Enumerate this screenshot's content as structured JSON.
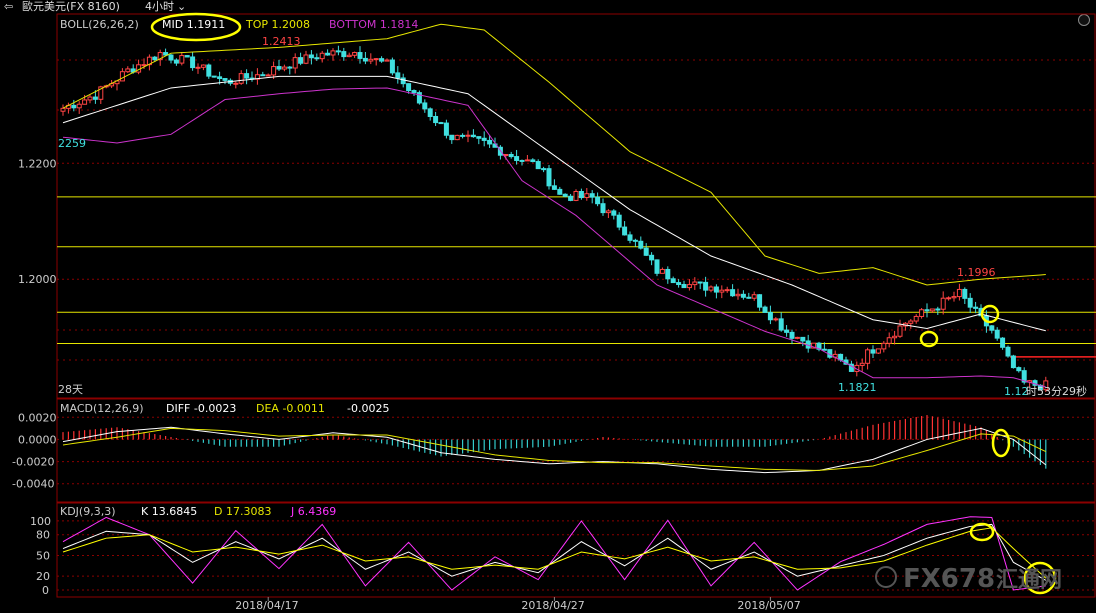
{
  "window": {
    "title": "歐元美元(FX 8160)",
    "period": "4小时"
  },
  "colors": {
    "up": "#ff4444",
    "down": "#40e0e0",
    "mid": "#ffffff",
    "top": "#e6e600",
    "bottom": "#cc33cc",
    "dead": "#ffff00",
    "grid": "#8b0000",
    "macd_pos": "#ff3333",
    "macd_neg": "#33cccc",
    "k": "#ffffff",
    "d": "#ffff00",
    "j": "#ff33ff"
  },
  "boll": {
    "label": "BOLL(26,26,2)",
    "mid_text": "MID 1.1911",
    "top_text": "TOP 1.2008",
    "bottom_text": "BOTTOM 1.1814"
  },
  "macd": {
    "label": "MACD(12,26,9)",
    "diff_text": "DIFF -0.0023",
    "dea_text": "DEA -0.0011",
    "value_text": "-0.0025"
  },
  "kdj": {
    "label": "KDJ(9,3,3)",
    "k_text": "K 13.6845",
    "d_text": "D 17.3083",
    "j_text": "J 6.4369"
  },
  "annotations": {
    "high_label": "1.2413",
    "left_label": "2259",
    "right_high_label": "1.1996",
    "low_label": "1.1821",
    "days_label": "28天",
    "last_label": "1.12",
    "countdown_label": "时53分29秒",
    "watermark": "FX678",
    "watermark_suffix": "汇通网"
  },
  "chart_data": {
    "type": "candlestick",
    "instrument": "歐元美元(FX 8160)",
    "interval": "4小时",
    "x_ticks": [
      {
        "index": 38,
        "label": "2018/04/17"
      },
      {
        "index": 91,
        "label": "2018/04/27"
      },
      {
        "index": 131,
        "label": "2018/05/07"
      }
    ],
    "price_ticks": [
      {
        "value": 1.22,
        "label": "1.2200"
      },
      {
        "value": 1.2,
        "label": "1.2000"
      }
    ],
    "macd_ticks": [
      {
        "value": 0.002,
        "label": "0.0020"
      },
      {
        "value": 0.0,
        "label": "0.0000"
      },
      {
        "value": -0.002,
        "label": "-0.0020"
      },
      {
        "value": -0.004,
        "label": "-0.0040"
      }
    ],
    "kdj_ticks": [
      {
        "value": 100,
        "label": "100"
      },
      {
        "value": 80,
        "label": "80"
      },
      {
        "value": 50,
        "label": "50"
      },
      {
        "value": 20,
        "label": "20"
      },
      {
        "value": 0,
        "label": "0"
      }
    ],
    "horizontal_levels": [
      1.2142,
      1.2056,
      1.1943,
      1.1889
    ],
    "current_price": 1.1866,
    "close_anchors": [
      [
        0,
        1.2295
      ],
      [
        6,
        1.2318
      ],
      [
        12,
        1.236
      ],
      [
        18,
        1.239
      ],
      [
        24,
        1.2372
      ],
      [
        30,
        1.234
      ],
      [
        36,
        1.2352
      ],
      [
        42,
        1.2372
      ],
      [
        48,
        1.2388
      ],
      [
        54,
        1.2392
      ],
      [
        60,
        1.237
      ],
      [
        66,
        1.2305
      ],
      [
        72,
        1.2245
      ],
      [
        78,
        1.2235
      ],
      [
        84,
        1.221
      ],
      [
        88,
        1.2195
      ],
      [
        92,
        1.2145
      ],
      [
        98,
        1.214
      ],
      [
        104,
        1.2085
      ],
      [
        110,
        1.2015
      ],
      [
        116,
        1.199
      ],
      [
        122,
        1.1985
      ],
      [
        128,
        1.1968
      ],
      [
        134,
        1.191
      ],
      [
        140,
        1.188
      ],
      [
        146,
        1.1845
      ],
      [
        150,
        1.188
      ],
      [
        156,
        1.1925
      ],
      [
        162,
        1.1955
      ],
      [
        166,
        1.1975
      ],
      [
        170,
        1.193
      ],
      [
        172,
        1.1912
      ],
      [
        175,
        1.186
      ],
      [
        178,
        1.182
      ],
      [
        182,
        1.1816
      ]
    ],
    "mid_anchors": [
      [
        0,
        1.227
      ],
      [
        20,
        1.233
      ],
      [
        40,
        1.235
      ],
      [
        60,
        1.235
      ],
      [
        75,
        1.232
      ],
      [
        90,
        1.222
      ],
      [
        105,
        1.212
      ],
      [
        120,
        1.204
      ],
      [
        135,
        1.199
      ],
      [
        150,
        1.193
      ],
      [
        160,
        1.1915
      ],
      [
        170,
        1.194
      ],
      [
        182,
        1.1911
      ]
    ],
    "top_anchors": [
      [
        0,
        1.2295
      ],
      [
        20,
        1.239
      ],
      [
        40,
        1.24
      ],
      [
        60,
        1.2415
      ],
      [
        70,
        1.244
      ],
      [
        78,
        1.243
      ],
      [
        90,
        1.234
      ],
      [
        105,
        1.222
      ],
      [
        120,
        1.215
      ],
      [
        130,
        1.204
      ],
      [
        140,
        1.201
      ],
      [
        150,
        1.202
      ],
      [
        160,
        1.199
      ],
      [
        170,
        1.2
      ],
      [
        182,
        1.2008
      ]
    ],
    "bottom_anchors": [
      [
        0,
        1.2245
      ],
      [
        10,
        1.2235
      ],
      [
        20,
        1.225
      ],
      [
        30,
        1.231
      ],
      [
        40,
        1.232
      ],
      [
        50,
        1.2328
      ],
      [
        60,
        1.233
      ],
      [
        75,
        1.23
      ],
      [
        85,
        1.217
      ],
      [
        95,
        1.211
      ],
      [
        110,
        1.199
      ],
      [
        120,
        1.195
      ],
      [
        130,
        1.191
      ],
      [
        140,
        1.188
      ],
      [
        150,
        1.183
      ],
      [
        160,
        1.183
      ],
      [
        170,
        1.1833
      ],
      [
        176,
        1.183
      ],
      [
        182,
        1.1814
      ]
    ],
    "macd_diff_anchors": [
      [
        0,
        -0.0002
      ],
      [
        10,
        0.0007
      ],
      [
        20,
        0.0011
      ],
      [
        30,
        0.0005
      ],
      [
        40,
        0.0
      ],
      [
        50,
        0.0006
      ],
      [
        60,
        0.0002
      ],
      [
        70,
        -0.0012
      ],
      [
        80,
        -0.0018
      ],
      [
        90,
        -0.0022
      ],
      [
        100,
        -0.002
      ],
      [
        110,
        -0.0022
      ],
      [
        120,
        -0.0027
      ],
      [
        130,
        -0.003
      ],
      [
        140,
        -0.0028
      ],
      [
        150,
        -0.0018
      ],
      [
        160,
        0.0
      ],
      [
        170,
        0.001
      ],
      [
        176,
        0.0
      ],
      [
        182,
        -0.0023
      ]
    ],
    "macd_dea_anchors": [
      [
        0,
        -0.0005
      ],
      [
        10,
        0.0002
      ],
      [
        20,
        0.001
      ],
      [
        30,
        0.0008
      ],
      [
        40,
        0.0003
      ],
      [
        50,
        0.0004
      ],
      [
        60,
        0.0004
      ],
      [
        70,
        -0.0005
      ],
      [
        80,
        -0.0014
      ],
      [
        90,
        -0.0019
      ],
      [
        100,
        -0.0021
      ],
      [
        110,
        -0.0021
      ],
      [
        120,
        -0.0024
      ],
      [
        130,
        -0.0027
      ],
      [
        140,
        -0.0028
      ],
      [
        150,
        -0.0024
      ],
      [
        160,
        -0.001
      ],
      [
        170,
        0.0005
      ],
      [
        176,
        0.0003
      ],
      [
        182,
        -0.0011
      ]
    ],
    "k_anchors": [
      [
        0,
        60
      ],
      [
        8,
        85
      ],
      [
        16,
        80
      ],
      [
        24,
        40
      ],
      [
        32,
        70
      ],
      [
        40,
        45
      ],
      [
        48,
        75
      ],
      [
        56,
        30
      ],
      [
        64,
        55
      ],
      [
        72,
        20
      ],
      [
        80,
        40
      ],
      [
        88,
        25
      ],
      [
        96,
        70
      ],
      [
        104,
        35
      ],
      [
        112,
        75
      ],
      [
        120,
        30
      ],
      [
        128,
        55
      ],
      [
        136,
        20
      ],
      [
        144,
        35
      ],
      [
        152,
        50
      ],
      [
        160,
        75
      ],
      [
        168,
        92
      ],
      [
        172,
        95
      ],
      [
        176,
        40
      ],
      [
        182,
        14
      ]
    ],
    "d_anchors": [
      [
        0,
        55
      ],
      [
        8,
        75
      ],
      [
        16,
        80
      ],
      [
        24,
        55
      ],
      [
        32,
        62
      ],
      [
        40,
        52
      ],
      [
        48,
        65
      ],
      [
        56,
        42
      ],
      [
        64,
        48
      ],
      [
        72,
        30
      ],
      [
        80,
        36
      ],
      [
        88,
        30
      ],
      [
        96,
        55
      ],
      [
        104,
        45
      ],
      [
        112,
        62
      ],
      [
        120,
        42
      ],
      [
        128,
        48
      ],
      [
        136,
        30
      ],
      [
        144,
        32
      ],
      [
        152,
        42
      ],
      [
        160,
        65
      ],
      [
        168,
        85
      ],
      [
        172,
        90
      ],
      [
        176,
        60
      ],
      [
        182,
        17
      ]
    ],
    "j_anchors": [
      [
        0,
        70
      ],
      [
        8,
        105
      ],
      [
        16,
        80
      ],
      [
        24,
        10
      ],
      [
        32,
        86
      ],
      [
        40,
        31
      ],
      [
        48,
        95
      ],
      [
        56,
        6
      ],
      [
        64,
        69
      ],
      [
        72,
        0
      ],
      [
        80,
        48
      ],
      [
        88,
        15
      ],
      [
        96,
        100
      ],
      [
        104,
        15
      ],
      [
        112,
        101
      ],
      [
        120,
        6
      ],
      [
        128,
        69
      ],
      [
        136,
        0
      ],
      [
        144,
        41
      ],
      [
        152,
        66
      ],
      [
        160,
        95
      ],
      [
        168,
        106
      ],
      [
        172,
        105
      ],
      [
        176,
        0
      ],
      [
        182,
        6
      ]
    ]
  }
}
